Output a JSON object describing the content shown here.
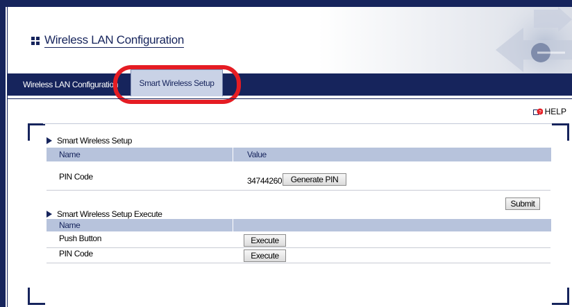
{
  "header": {
    "title": "Wireless LAN Configuration"
  },
  "nav": {
    "tabs": [
      {
        "label": "Wireless LAN Configuration",
        "active": false
      },
      {
        "label": "Smart Wireless Setup",
        "active": true
      }
    ]
  },
  "help": {
    "label": "HELP"
  },
  "setup_section": {
    "title": "Smart Wireless Setup",
    "columns": [
      "Name",
      "Value"
    ],
    "rows": [
      {
        "name": "PIN Code",
        "value": "34744260",
        "button": "Generate PIN"
      }
    ],
    "submit_label": "Submit"
  },
  "execute_section": {
    "title": "Smart Wireless Setup Execute",
    "columns": [
      "Name",
      ""
    ],
    "rows": [
      {
        "name": "Push Button",
        "button": "Execute"
      },
      {
        "name": "PIN Code",
        "button": "Execute"
      }
    ]
  },
  "colors": {
    "brand_navy": "#16245c",
    "table_header": "#b7c3dc",
    "highlight_red": "#e51c23"
  },
  "icons": {
    "title": "grid-icon",
    "help": "help-icon",
    "section": "triangle-right-icon",
    "logo": "arrows-logo-icon"
  }
}
